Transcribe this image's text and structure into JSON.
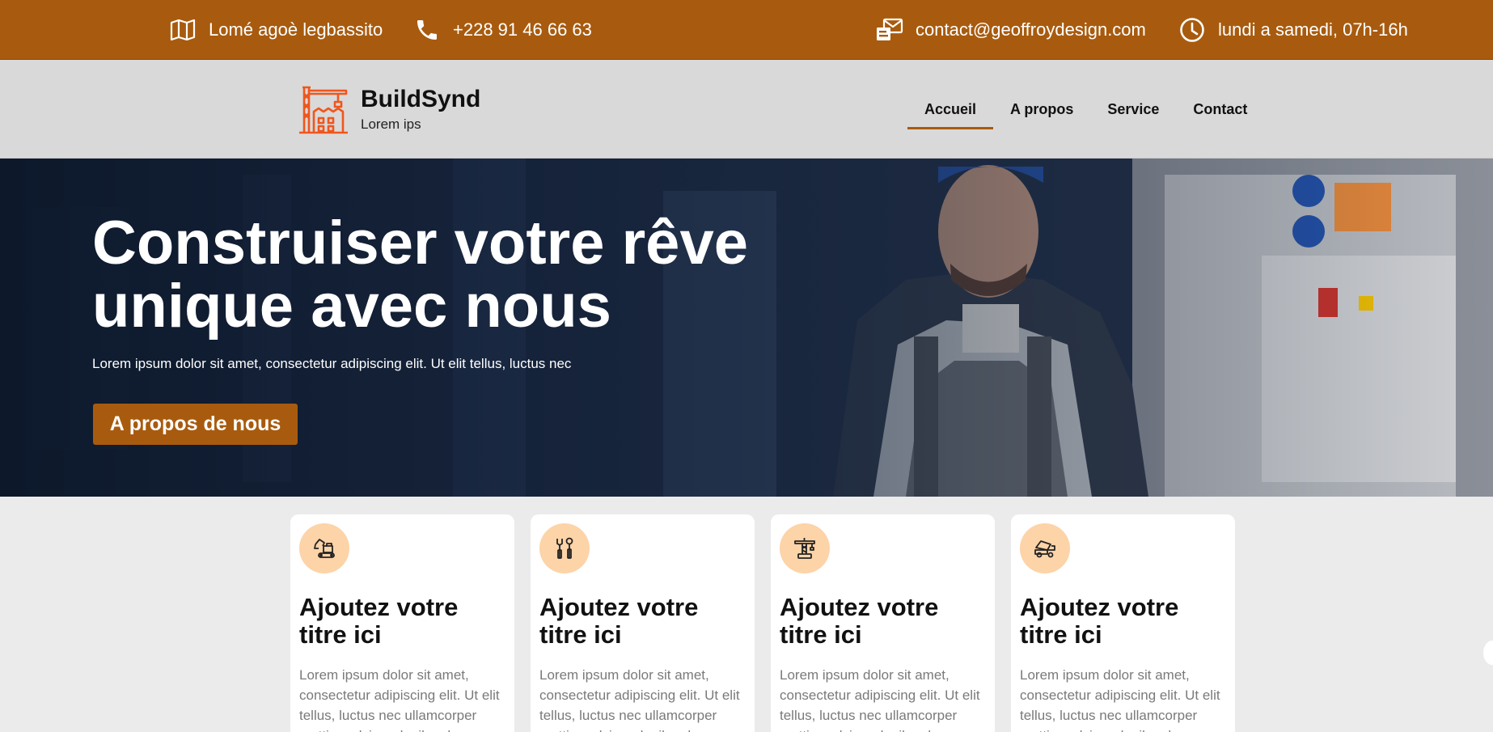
{
  "topbar": {
    "address": "Lomé agoè legbassito",
    "phone": "+228 91 46 66 63",
    "email": "contact@geoffroydesign.com",
    "hours": "lundi a samedi, 07h-16h"
  },
  "brand": {
    "name": "BuildSynd",
    "tagline": "Lorem ips"
  },
  "nav": {
    "items": [
      {
        "label": "Accueil",
        "active": true
      },
      {
        "label": "A propos",
        "active": false
      },
      {
        "label": "Service",
        "active": false
      },
      {
        "label": "Contact",
        "active": false
      }
    ]
  },
  "hero": {
    "title_line1": "Construiser votre rêve",
    "title_line2": "unique avec nous",
    "subtitle": "Lorem ipsum dolor sit amet, consectetur adipiscing elit. Ut elit tellus, luctus nec",
    "button_label": "A propos de nous"
  },
  "cards": [
    {
      "icon": "excavator-icon",
      "title": "Ajoutez votre titre ici",
      "text": "Lorem ipsum dolor sit amet, consectetur adipiscing elit. Ut elit tellus, luctus nec ullamcorper mattis, pulvinar dapibus leo."
    },
    {
      "icon": "tools-icon",
      "title": "Ajoutez votre titre ici",
      "text": "Lorem ipsum dolor sit amet, consectetur adipiscing elit. Ut elit tellus, luctus nec ullamcorper mattis, pulvinar dapibus leo."
    },
    {
      "icon": "crane-icon",
      "title": "Ajoutez votre titre ici",
      "text": "Lorem ipsum dolor sit amet, consectetur adipiscing elit. Ut elit tellus, luctus nec ullamcorper mattis, pulvinar dapibus leo."
    },
    {
      "icon": "dump-truck-icon",
      "title": "Ajoutez votre titre ici",
      "text": "Lorem ipsum dolor sit amet, consectetur adipiscing elit. Ut elit tellus, luctus nec ullamcorper mattis, pulvinar dapibus leo."
    }
  ],
  "colors": {
    "accent": "#a85b0e",
    "logo": "#f0561c",
    "icon_bg": "#fdd3a8"
  }
}
